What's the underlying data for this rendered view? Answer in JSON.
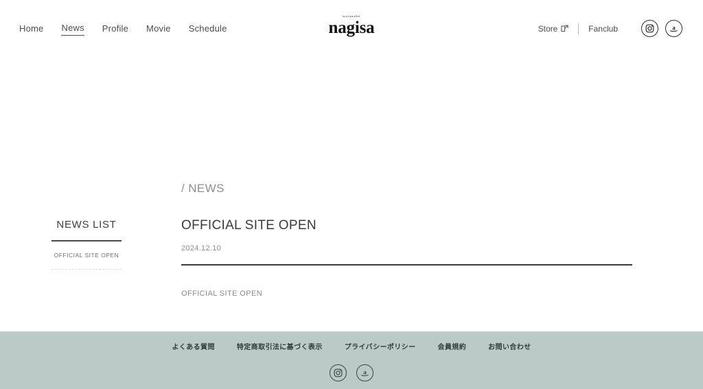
{
  "header": {
    "nav": [
      {
        "label": "Home",
        "active": false
      },
      {
        "label": "News",
        "active": true
      },
      {
        "label": "Profile",
        "active": false
      },
      {
        "label": "Movie",
        "active": false
      },
      {
        "label": "Schedule",
        "active": false
      }
    ],
    "logo": {
      "sup": "watanabe",
      "name": "nagisa"
    },
    "utility": {
      "store_label": "Store",
      "store_icon": "external-link-icon",
      "fanclub_label": "Fanclub"
    },
    "social": [
      {
        "name": "instagram-icon"
      },
      {
        "name": "amazon-icon"
      }
    ]
  },
  "main": {
    "breadcrumb": "/ NEWS",
    "sidebar": {
      "title": "NEWS LIST",
      "items": [
        {
          "label": "OFFICIAL SITE OPEN"
        }
      ]
    },
    "article": {
      "title": "OFFICIAL SITE OPEN",
      "date": "2024.12.10",
      "body": "OFFICIAL SITE OPEN"
    }
  },
  "footer": {
    "links": [
      {
        "label": "よくある質問"
      },
      {
        "label": "特定商取引法に基づく表示"
      },
      {
        "label": "プライバシーポリシー"
      },
      {
        "label": "会員規約"
      },
      {
        "label": "お問い合わせ"
      }
    ],
    "social": [
      {
        "name": "instagram-icon"
      },
      {
        "name": "amazon-icon"
      }
    ],
    "background_color": "#bccac7"
  }
}
